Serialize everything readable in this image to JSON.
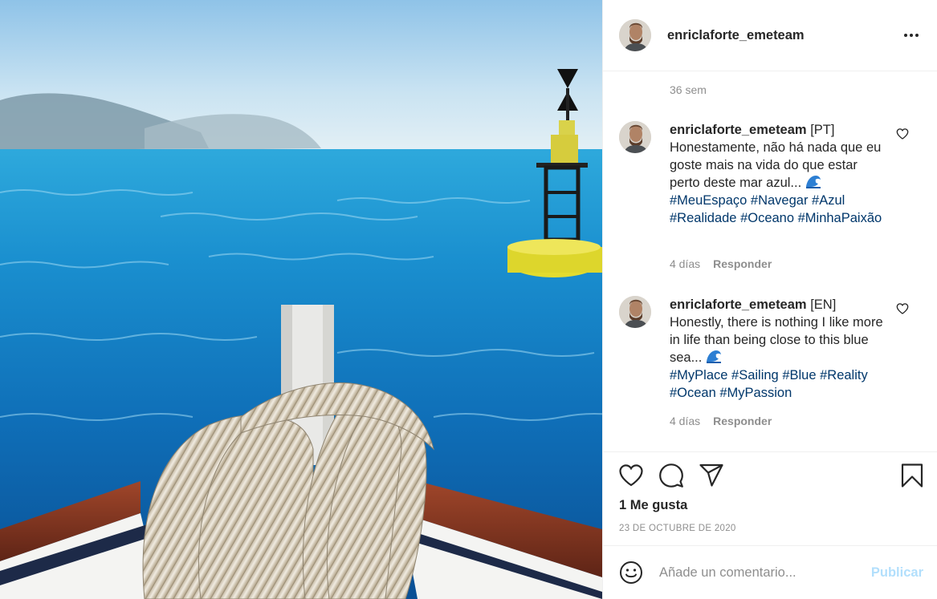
{
  "post": {
    "username": "enriclaforte_emeteam",
    "time_ago": "36 sem",
    "likes_text": "1 Me gusta",
    "date": "23 DE OCTUBRE DE 2020"
  },
  "comments": [
    {
      "username": "enriclaforte_emeteam",
      "lang_tag": "[PT]",
      "text": "Honestamente, não há nada que eu goste mais na vida do que estar perto deste mar azul...",
      "emoji": "🌊",
      "hashtags": "#MeuEspaço #Navegar #Azul #Realidade #Oceano #MinhaPaixão",
      "age": "4 días",
      "reply_label": "Responder"
    },
    {
      "username": "enriclaforte_emeteam",
      "lang_tag": "[EN]",
      "text": "Honestly, there is nothing I like more in life than being close to this blue sea...",
      "emoji": "🌊",
      "hashtags": "#MyPlace #Sailing #Blue #Reality #Ocean #MyPassion",
      "age": "4 días",
      "reply_label": "Responder"
    }
  ],
  "add_comment": {
    "placeholder": "Añade un comentario...",
    "publish_label": "Publicar"
  },
  "icons": {
    "more": "more-options-icon",
    "like": "heart-icon",
    "comment": "comment-icon",
    "share": "share-icon",
    "save": "bookmark-icon",
    "emoji": "emoji-icon",
    "comment_like": "heart-icon"
  },
  "colors": {
    "hashtag": "#00376b",
    "muted": "#8e8e8e",
    "publish_disabled": "#b2dffc",
    "text": "#262626"
  }
}
